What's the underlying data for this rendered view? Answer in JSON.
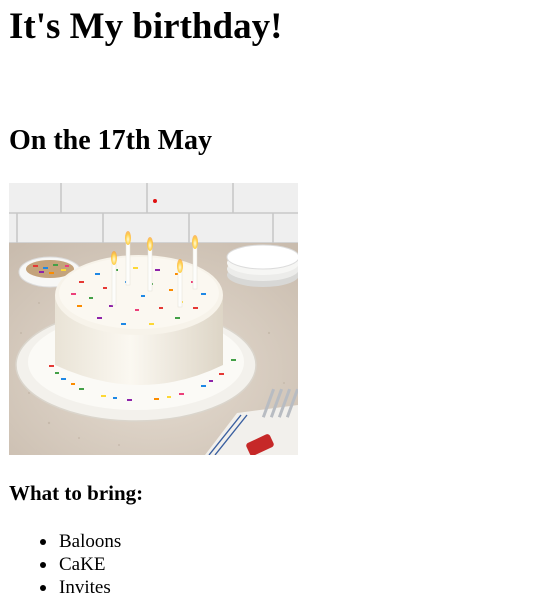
{
  "heading": "It's My birthday!",
  "date_heading": "On the 17th May",
  "image": {
    "subject": "birthday cake with sprinkles and lit candles on a white plate"
  },
  "bring_heading": "What to bring:",
  "bring_items": [
    {
      "label": "Baloons"
    },
    {
      "label": "CaKE"
    },
    {
      "label": "Invites"
    }
  ],
  "colors": {
    "text": "#000000",
    "background": "#ffffff"
  }
}
